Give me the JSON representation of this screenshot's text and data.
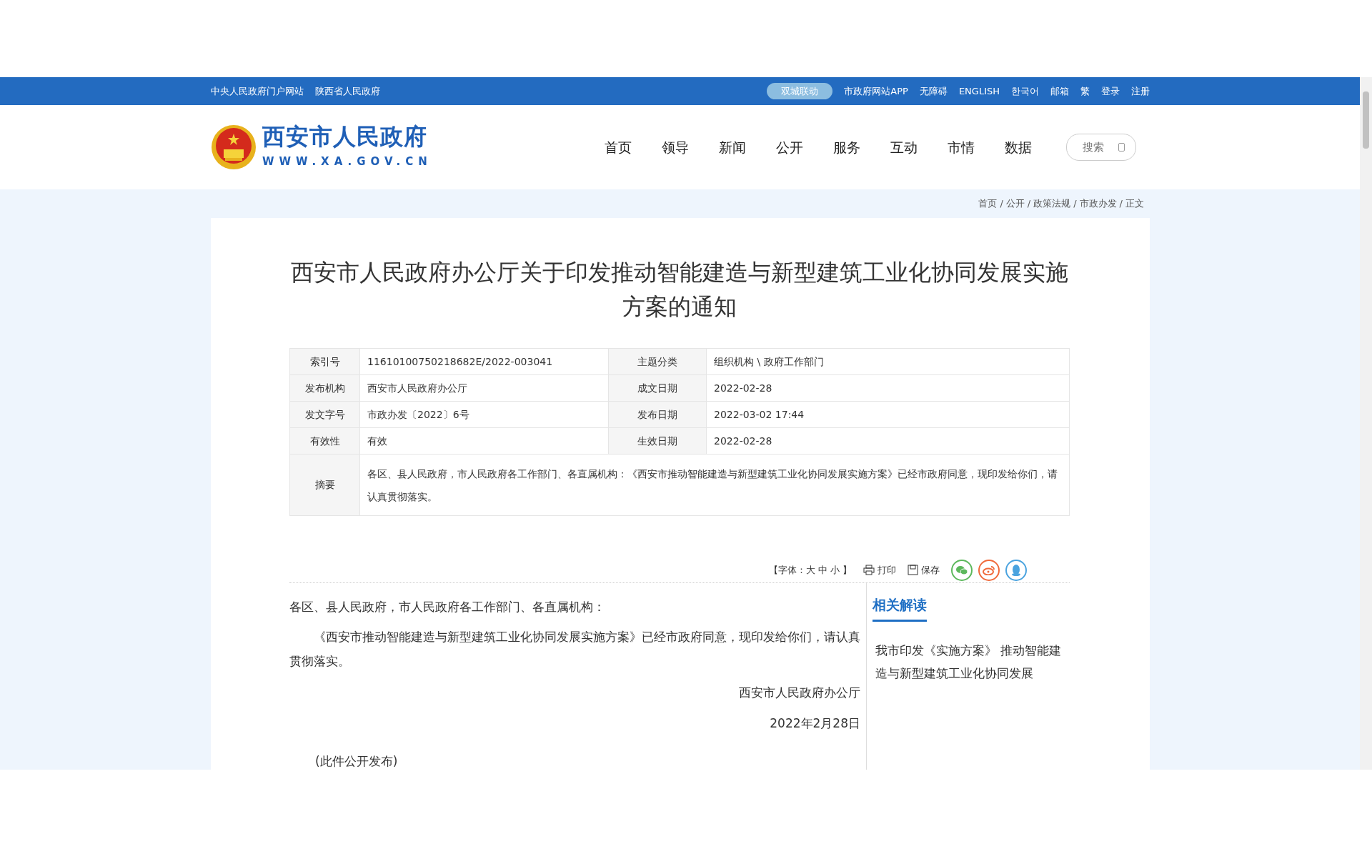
{
  "top_bar": {
    "left_links": [
      "中央人民政府门户网站",
      "陕西省人民政府"
    ],
    "pill": "双城联动",
    "right_links": [
      "市政府网站APP",
      "无障碍",
      "ENGLISH",
      "한국어",
      "邮箱",
      "繁",
      "登录",
      "注册"
    ]
  },
  "header": {
    "site_name": "西安市人民政府",
    "site_url": "WWW.XA.GOV.CN",
    "nav": [
      {
        "label": "首页",
        "selected": false
      },
      {
        "label": "领导",
        "selected": false
      },
      {
        "label": "新闻",
        "selected": false
      },
      {
        "label": "公开",
        "selected": false
      },
      {
        "label": "服务",
        "selected": false
      },
      {
        "label": "互动",
        "selected": false
      },
      {
        "label": "市情",
        "selected": false
      },
      {
        "label": "数据",
        "selected": false
      }
    ],
    "search": {
      "placeholder": "搜索"
    }
  },
  "breadcrumb": {
    "items": [
      "首页",
      "公开",
      "政策法规",
      "市政办发",
      "正文"
    ],
    "separator": "/"
  },
  "article": {
    "title": "西安市人民政府办公厅关于印发推动智能建造与新型建筑工业化协同发展实施方案的通知",
    "info_rows": [
      [
        {
          "label": "索引号",
          "value": "11610100750218682E/2022-003041"
        },
        {
          "label": "主题分类",
          "value": "组织机构 \\ 政府工作部门"
        }
      ],
      [
        {
          "label": "发布机构",
          "value": "西安市人民政府办公厅"
        },
        {
          "label": "成文日期",
          "value": "2022-02-28"
        }
      ],
      [
        {
          "label": "发文字号",
          "value": "市政办发〔2022〕6号"
        },
        {
          "label": "发布日期",
          "value": "2022-03-02 17:44"
        }
      ],
      [
        {
          "label": "有效性",
          "value": "有效"
        },
        {
          "label": "生效日期",
          "value": "2022-02-28"
        }
      ]
    ],
    "summary": {
      "label": "摘要",
      "value": "各区、县人民政府，市人民政府各工作部门、各直属机构：《西安市推动智能建造与新型建筑工业化协同发展实施方案》已经市政府同意，现印发给你们，请认真贯彻落实。"
    },
    "toolbar": {
      "font_label": "【字体：",
      "sizes": [
        "大",
        "中",
        "小"
      ],
      "font_end": "】",
      "print": "打印",
      "save": "保存"
    },
    "body": [
      {
        "kind": "salutation",
        "text": "各区、县人民政府，市人民政府各工作部门、各直属机构："
      },
      {
        "kind": "paragraph",
        "text": "《西安市推动智能建造与新型建筑工业化协同发展实施方案》已经市政府同意，现印发给你们，请认真贯彻落实。"
      },
      {
        "kind": "signature",
        "text": "西安市人民政府办公厅"
      },
      {
        "kind": "signature",
        "text": "2022年2月28日"
      },
      {
        "kind": "note",
        "text": "(此件公开发布)"
      }
    ],
    "related": {
      "heading": "相关解读",
      "items": [
        "我市印发《实施方案》 推动智能建造与新型建筑工业化协同发展"
      ]
    }
  }
}
